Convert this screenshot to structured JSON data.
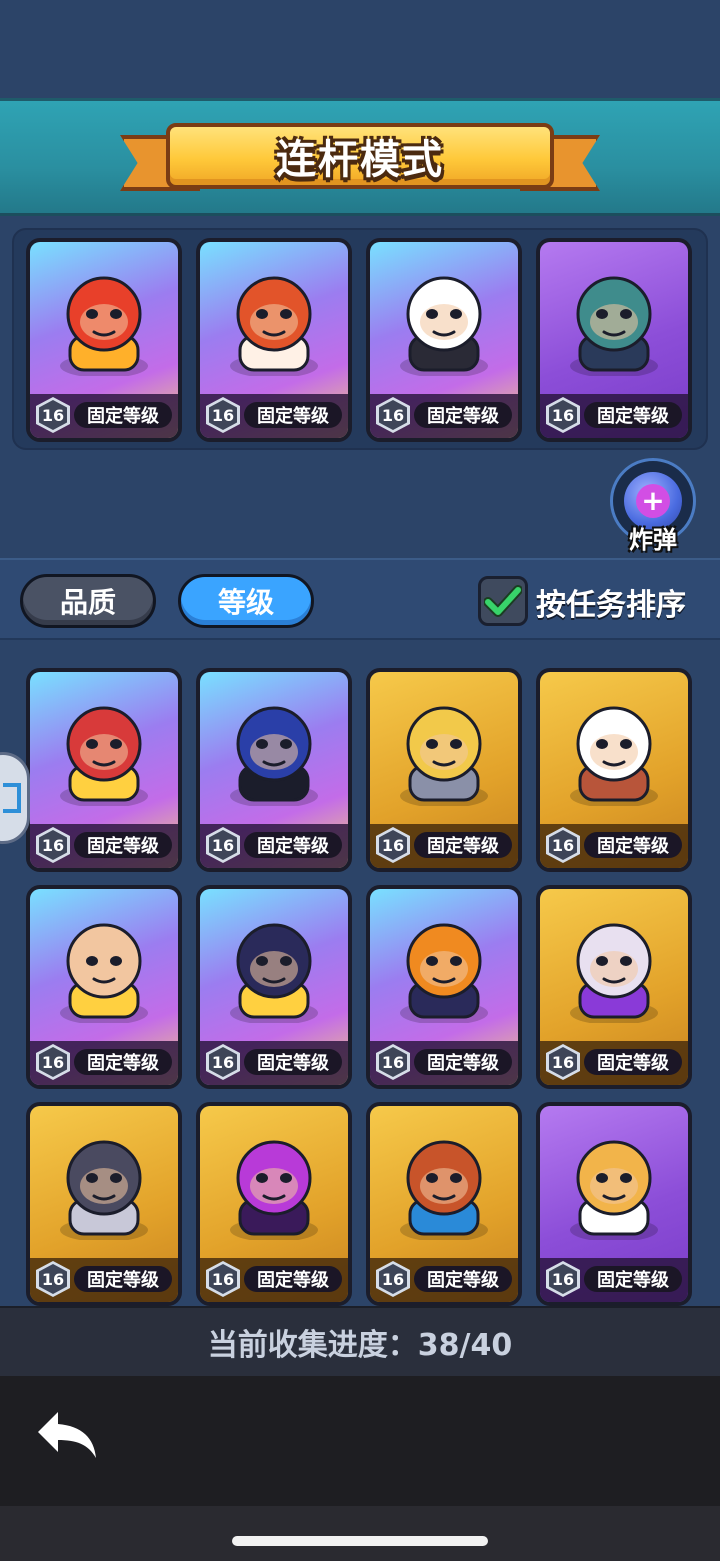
{
  "header": {
    "title": "连杆模式"
  },
  "team": {
    "cards": [
      {
        "level": "16",
        "label": "固定等级",
        "rarity": "epic",
        "icon": "phoenix-hero-icon"
      },
      {
        "level": "16",
        "label": "固定等级",
        "rarity": "epic",
        "icon": "lizard-hero-icon"
      },
      {
        "level": "16",
        "label": "固定等级",
        "rarity": "epic",
        "icon": "panda-hero-icon"
      },
      {
        "level": "16",
        "label": "固定等级",
        "rarity": "purple",
        "icon": "zombie-hero-icon"
      }
    ]
  },
  "bomb": {
    "label": "炸弹"
  },
  "filters": {
    "quality_label": "品质",
    "level_label": "等级",
    "sort_label": "按任务排序",
    "sort_checked": true
  },
  "collection": {
    "cards": [
      {
        "level": "16",
        "label": "固定等级",
        "rarity": "epic",
        "icon": "samurai-hero-icon"
      },
      {
        "level": "16",
        "label": "固定等级",
        "rarity": "epic",
        "icon": "anubis-hero-icon"
      },
      {
        "level": "16",
        "label": "固定等级",
        "rarity": "gold",
        "icon": "knight-hero-icon"
      },
      {
        "level": "16",
        "label": "固定等级",
        "rarity": "gold",
        "icon": "old-mechanic-hero-icon"
      },
      {
        "level": "16",
        "label": "固定等级",
        "rarity": "epic",
        "icon": "monk-hero-icon"
      },
      {
        "level": "16",
        "label": "固定等级",
        "rarity": "epic",
        "icon": "pirate-hero-icon"
      },
      {
        "level": "16",
        "label": "固定等级",
        "rarity": "epic",
        "icon": "pumpkin-hero-icon"
      },
      {
        "level": "16",
        "label": "固定等级",
        "rarity": "gold",
        "icon": "vampire-maid-hero-icon"
      },
      {
        "level": "16",
        "label": "固定等级",
        "rarity": "gold",
        "icon": "wolf-hero-icon"
      },
      {
        "level": "16",
        "label": "固定等级",
        "rarity": "gold",
        "icon": "spider-hero-icon"
      },
      {
        "level": "16",
        "label": "固定等级",
        "rarity": "gold",
        "icon": "tribal-girl-hero-icon"
      },
      {
        "level": "16",
        "label": "固定等级",
        "rarity": "purple",
        "icon": "tiger-pirate-hero-icon"
      }
    ]
  },
  "progress": {
    "text": "当前收集进度：38/40"
  },
  "colors": {
    "accent_blue": "#3aa4ff",
    "ribbon_gold": "#ffc93a",
    "check_green": "#38d46a"
  }
}
